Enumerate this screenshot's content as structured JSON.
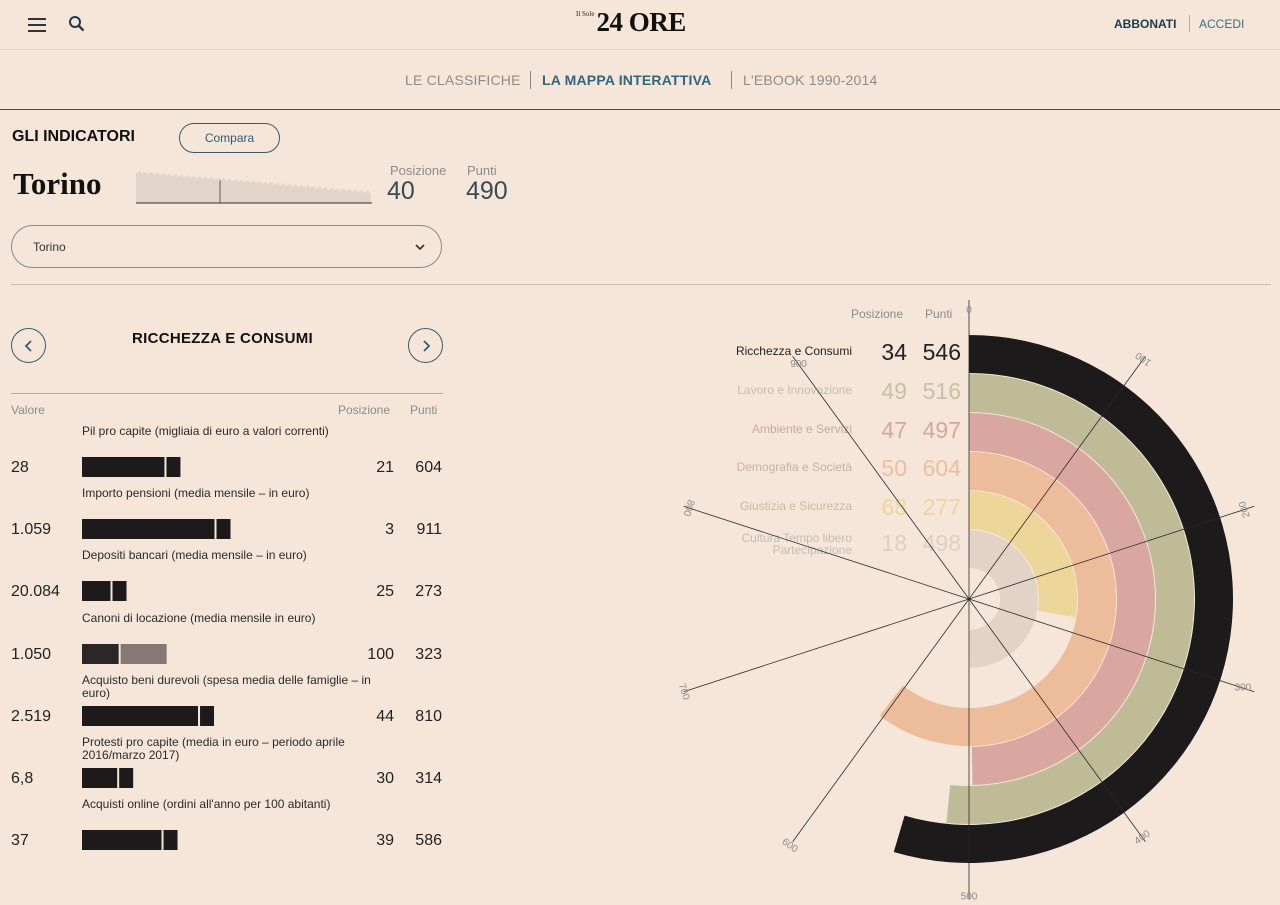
{
  "header": {
    "logo_small": "Il Sole",
    "logo_big": "24 ORE",
    "subscribe_label": "ABBONATI",
    "login_label": "ACCEDI"
  },
  "subnav": [
    {
      "label": "LE CLASSIFICHE",
      "active": false
    },
    {
      "label": "LA MAPPA INTERATTIVA",
      "active": true
    },
    {
      "label": "L'EBOOK 1990-2014",
      "active": false
    }
  ],
  "indicators": {
    "title": "GLI INDICATORI",
    "compare_label": "Compara",
    "city": "Torino",
    "position_label": "Posizione",
    "position_value": "40",
    "points_label": "Punti",
    "points_value": "490",
    "select_value": "Torino"
  },
  "section": {
    "title": "RICCHEZZA E CONSUMI",
    "col_value": "Valore",
    "col_position": "Posizione",
    "col_points": "Punti",
    "rows": [
      {
        "label": "Pil pro capite (migliaia di euro a valori correnti)",
        "value": "28",
        "position": "21",
        "points": "604",
        "bar": 0.604
      },
      {
        "label": "Importo pensioni (media mensile – in euro)",
        "value": "1.059",
        "position": "3",
        "points": "911",
        "bar": 0.911
      },
      {
        "label": "Depositi bancari (media mensile – in euro)",
        "value": "20.084",
        "position": "25",
        "points": "273",
        "bar": 0.273
      },
      {
        "label": "Canoni di locazione (media mensile in euro)",
        "value": "1.050",
        "position": "100",
        "points": "323",
        "bar": 0.323
      },
      {
        "label": "Acquisto beni durevoli (spesa media delle famiglie – in euro)",
        "value": "2.519",
        "position": "44",
        "points": "810",
        "bar": 0.81
      },
      {
        "label": "Protesti pro capite (media in euro – periodo aprile 2016/marzo 2017)",
        "value": "6,8",
        "position": "30",
        "points": "314",
        "bar": 0.314
      },
      {
        "label": "Acquisti online (ordini all'anno per 100 abitanti)",
        "value": "37",
        "position": "39",
        "points": "586",
        "bar": 0.586
      }
    ]
  },
  "radial": {
    "col_position": "Posizione",
    "col_points": "Punti",
    "zero_label": "0",
    "axis_labels": [
      "100",
      "200",
      "300",
      "400",
      "500",
      "600",
      "700",
      "800",
      "900"
    ],
    "categories": [
      {
        "name": "Ricchezza e Consumi",
        "position": "34",
        "points": "546",
        "color": "#1c1a1b",
        "name_color": "#222222",
        "num_color": "#222222"
      },
      {
        "name": "Lavoro e Innovazione",
        "position": "49",
        "points": "516",
        "color": "#bfbb97",
        "name_color": "#c4bcab",
        "num_color": "#c7c0a6"
      },
      {
        "name": "Ambiente e Servizi",
        "position": "47",
        "points": "497",
        "color": "#d9a79f",
        "name_color": "#caa8a0",
        "num_color": "#d8a59d"
      },
      {
        "name": "Demografia e Società",
        "position": "50",
        "points": "604",
        "color": "#edbc9b",
        "name_color": "#c9b0a0",
        "num_color": "#edbf9f"
      },
      {
        "name": "Giustizia e Sicurezza",
        "position": "68",
        "points": "277",
        "color": "#ecd69a",
        "name_color": "#c5b9a6",
        "num_color": "#ebd79d"
      },
      {
        "name": "Cultura Tempo libero Partecipazione",
        "position": "18",
        "points": "498",
        "color": "#e2d3c6",
        "name_color": "#c5bcb2",
        "num_color": "#dcd0c4"
      }
    ]
  }
}
